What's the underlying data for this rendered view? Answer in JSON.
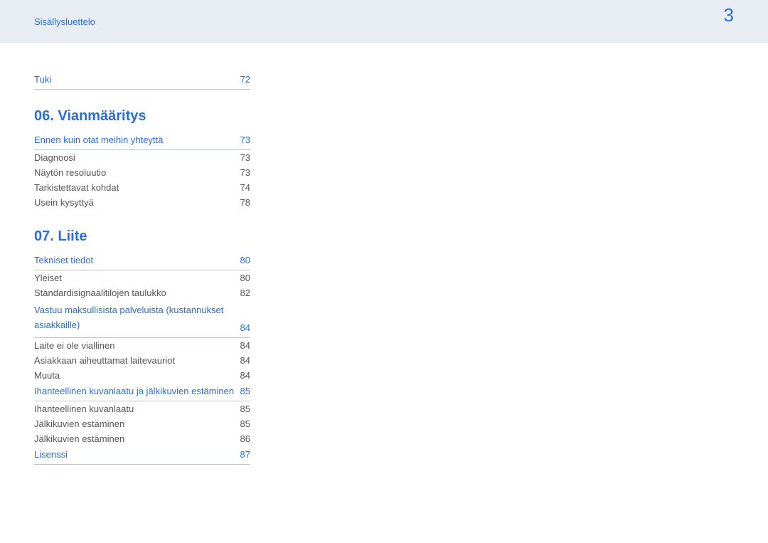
{
  "header": {
    "breadcrumb": "Sisällysluettelo",
    "pageNumber": "3"
  },
  "top_entry": {
    "label": "Tuki",
    "page": "72"
  },
  "section06": {
    "heading": "06.  Vianmääritys",
    "main_link": {
      "label": "Ennen kuin otat meihin yhteyttä",
      "page": "73"
    },
    "subs": [
      {
        "label": "Diagnoosi",
        "page": "73"
      },
      {
        "label": "Näytön resoluutio",
        "page": "73"
      },
      {
        "label": "Tarkistettavat kohdat",
        "page": "74"
      },
      {
        "label": "Usein kysyttyä",
        "page": "78"
      }
    ]
  },
  "section07": {
    "heading": "07.   Liite",
    "group1": {
      "link": {
        "label": "Tekniset tiedot",
        "page": "80"
      },
      "subs": [
        {
          "label": "Yleiset",
          "page": "80"
        },
        {
          "label": "Standardisignaalitilojen taulukko",
          "page": "82"
        }
      ]
    },
    "group2": {
      "link": {
        "label": "Vastuu maksullisista palveluista (kustannukset asiakkaille)",
        "page": "84"
      },
      "subs": [
        {
          "label": "Laite ei ole viallinen",
          "page": "84"
        },
        {
          "label": "Asiakkaan aiheuttamat laitevauriot",
          "page": "84"
        },
        {
          "label": "Muuta",
          "page": "84"
        }
      ]
    },
    "group3": {
      "link": {
        "label": "Ihanteellinen kuvanlaatu ja jälkikuvien estäminen",
        "page": "85"
      },
      "subs": [
        {
          "label": "Ihanteellinen kuvanlaatu",
          "page": "85"
        },
        {
          "label": "Jälkikuvien estäminen",
          "page": "85"
        },
        {
          "label": "Jälkikuvien estäminen",
          "page": "86"
        }
      ]
    },
    "group4": {
      "link": {
        "label": "Lisenssi",
        "page": "87"
      }
    }
  }
}
